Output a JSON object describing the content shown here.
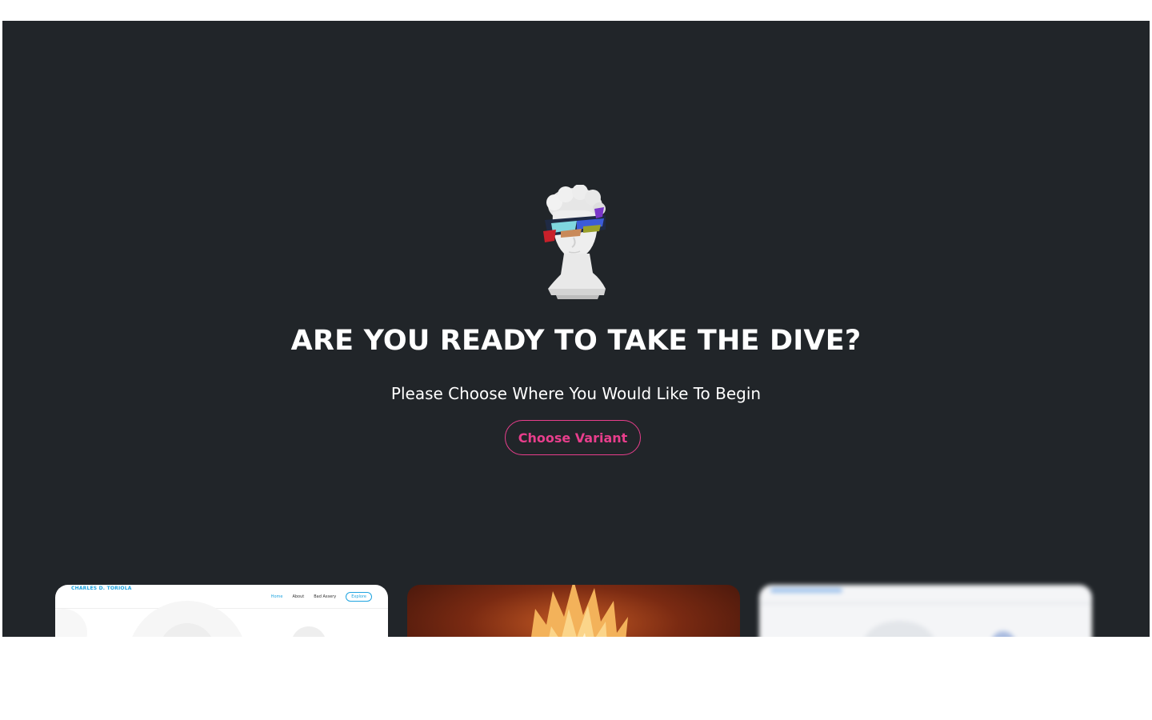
{
  "hero": {
    "headline": "ARE YOU READY TO TAKE THE DIVE?",
    "subline": "Please Choose Where You Would Like To Begin",
    "cta_label": "Choose Variant",
    "avatar_icon": "statue-head-avatar-icon"
  },
  "colors": {
    "background": "#212529",
    "accent": "#e83e8c",
    "text": "#ffffff"
  },
  "previews": {
    "card1": {
      "brand": "CHARLES D. TORIOLA",
      "nav": [
        "Home",
        "About",
        "Bad Assery"
      ],
      "nav_button": "Explore"
    }
  }
}
